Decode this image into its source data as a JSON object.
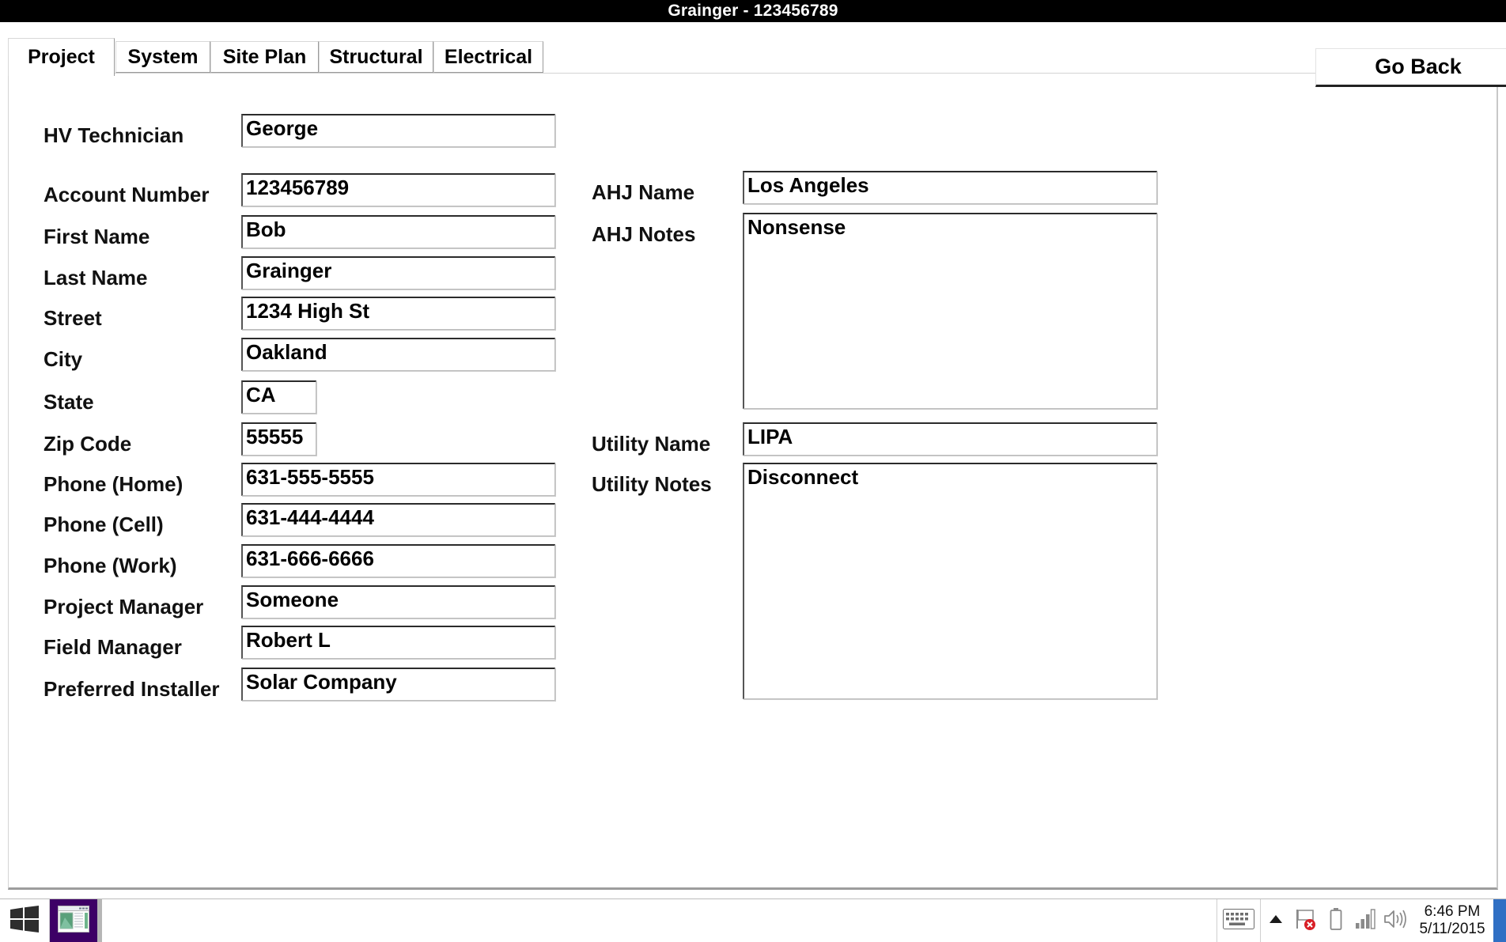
{
  "window": {
    "title": "Grainger - 123456789"
  },
  "toolbar": {
    "go_back_label": "Go Back"
  },
  "tabs": [
    {
      "label": "Project",
      "selected": true
    },
    {
      "label": "System",
      "selected": false
    },
    {
      "label": "Site Plan",
      "selected": false
    },
    {
      "label": "Structural",
      "selected": false
    },
    {
      "label": "Electrical",
      "selected": false
    }
  ],
  "form": {
    "left": [
      {
        "label": "HV Technician",
        "value": "George"
      },
      {
        "label": "Account Number",
        "value": "123456789"
      },
      {
        "label": "First Name",
        "value": "Bob"
      },
      {
        "label": "Last Name",
        "value": "Grainger"
      },
      {
        "label": "Street",
        "value": "1234 High St"
      },
      {
        "label": "City",
        "value": "Oakland"
      },
      {
        "label": "State",
        "value": "CA"
      },
      {
        "label": "Zip Code",
        "value": "55555"
      },
      {
        "label": "Phone (Home)",
        "value": "631-555-5555"
      },
      {
        "label": "Phone (Cell)",
        "value": "631-444-4444"
      },
      {
        "label": "Phone (Work)",
        "value": "631-666-6666"
      },
      {
        "label": "Project Manager",
        "value": "Someone"
      },
      {
        "label": "Field Manager",
        "value": "Robert L"
      },
      {
        "label": "Preferred Installer",
        "value": "Solar Company"
      }
    ],
    "right": [
      {
        "label": "AHJ Name",
        "value": "Los Angeles"
      },
      {
        "label": "AHJ Notes",
        "value": "Nonsense"
      },
      {
        "label": "Utility Name",
        "value": "LIPA"
      },
      {
        "label": "Utility Notes",
        "value": "Disconnect"
      }
    ]
  },
  "taskbar": {
    "start_icon": "windows-logo-icon",
    "task_icon": "application-window-icon",
    "tray": {
      "keyboard_icon": "keyboard-icon",
      "overflow_icon": "chevron-up-icon",
      "action_center_icon": "flag-error-icon",
      "battery_icon": "battery-icon",
      "network_icon": "signal-bars-icon",
      "volume_icon": "speaker-icon",
      "time": "6:46 PM",
      "date": "5/11/2015"
    }
  },
  "colors": {
    "titlebar_bg": "#000000",
    "titlebar_fg": "#ffffff",
    "taskbar_highlight": "#3d0066",
    "accent": "#2f6fc4",
    "error": "#d81f26"
  }
}
